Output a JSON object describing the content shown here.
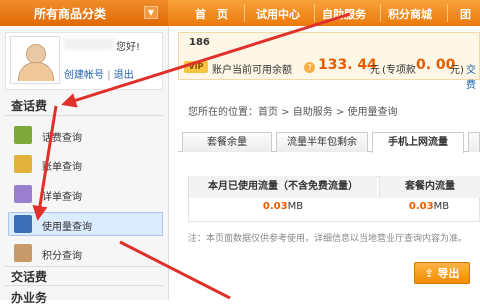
{
  "topnav": {
    "category_label": "所有商品分类",
    "items": [
      "首　页",
      "试用中心",
      "自助服务",
      "积分商城",
      "团"
    ]
  },
  "user": {
    "greeting": "您好!",
    "create_account": "创建帐号",
    "separator": "|",
    "logout": "退出"
  },
  "sidebar": {
    "section1_title": "查话费",
    "items": [
      {
        "label": "话费查询",
        "icon": "phone-bill-icon"
      },
      {
        "label": "账单查询",
        "icon": "bill-icon"
      },
      {
        "label": "详单查询",
        "icon": "detail-icon"
      },
      {
        "label": "使用量查询",
        "icon": "usage-search-icon"
      },
      {
        "label": "积分查询",
        "icon": "points-icon"
      }
    ],
    "section2_title": "交话费",
    "section3_title": "办业务"
  },
  "account": {
    "phone": "186",
    "vip": "VIP",
    "balance_label": "账户当前可用余额",
    "balance": "133. 44",
    "unit": "元",
    "special_label": "(专项款",
    "special_balance": "0. 00",
    "special_unit": "元)",
    "action": "交费"
  },
  "breadcrumb": "您所在的位置：首页 > 自助服务 > 使用量查询",
  "tabs": [
    "套餐余量",
    "流量半年包剩余",
    "手机上网流量"
  ],
  "table": {
    "headers": [
      "本月已使用流量（不含免费流量）",
      "套餐内流量"
    ],
    "values": [
      "0.03",
      "0.03"
    ],
    "unit": "MB"
  },
  "note": "注：本页面数据仅供参考使用，详细信息以当地营业厅查询内容为准。",
  "export_label": "导出",
  "colors": {
    "accent": "#ec7a0d",
    "highlight": "#e65c00",
    "arrow": "#e0302a"
  }
}
